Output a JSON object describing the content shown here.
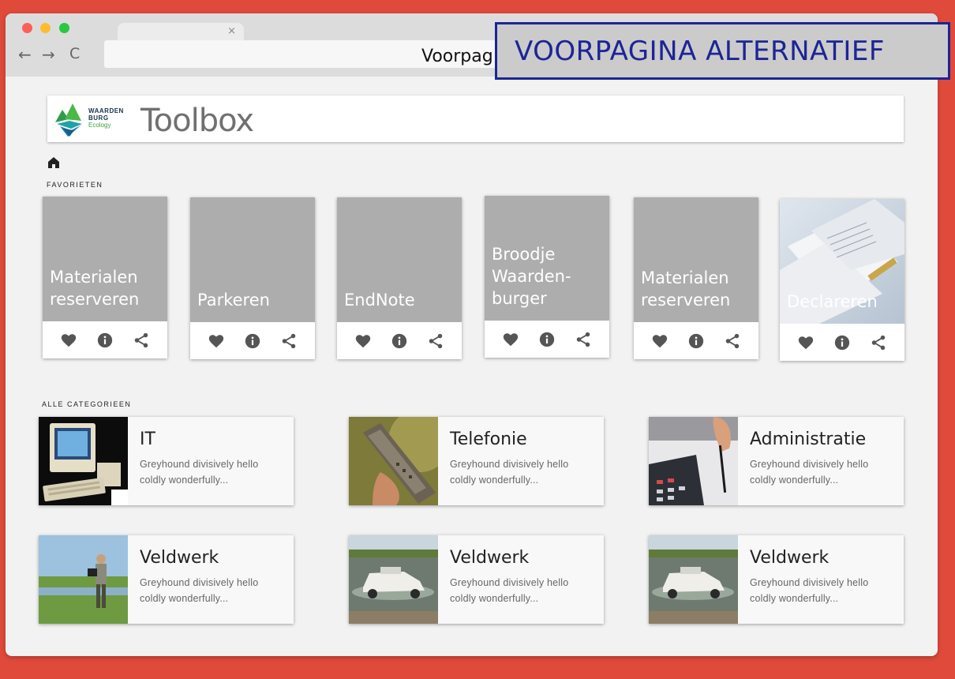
{
  "overlay_label": "VOORPAGINA ALTERNATIEF",
  "browser": {
    "tab_close": "×",
    "back_icon": "←",
    "forward_icon": "→",
    "reload_icon": "C",
    "address_text": "Voorpag"
  },
  "header": {
    "logo_line1": "WAARDEN",
    "logo_line2": "BURG",
    "logo_line3": "Ecology",
    "app_title": "Toolbox"
  },
  "favorites": {
    "section_label": "FAVORIETEN",
    "items": [
      {
        "title": "Materialen\nreserveren",
        "has_image": false
      },
      {
        "title": "Parkeren",
        "has_image": false
      },
      {
        "title": "EndNote",
        "has_image": false
      },
      {
        "title": "Broodje\nWaarden-\nburger",
        "has_image": false
      },
      {
        "title": "Materialen\nreserveren",
        "has_image": false
      },
      {
        "title": "Declareren",
        "has_image": true
      }
    ],
    "action_icons": [
      "heart-icon",
      "info-icon",
      "share-icon"
    ]
  },
  "categories": {
    "section_label": "ALLE CATEGORIEEN",
    "items": [
      {
        "title": "IT",
        "description": "Greyhound divisively hello coldly wonderfully...",
        "image": "vintage-computer"
      },
      {
        "title": "Telefonie",
        "description": "Greyhound divisively hello coldly wonderfully...",
        "image": "brick-phone"
      },
      {
        "title": "Administratie",
        "description": "Greyhound divisively hello coldly wonderfully...",
        "image": "calculator-pen"
      },
      {
        "title": "Veldwerk",
        "description": "Greyhound divisively hello coldly wonderfully...",
        "image": "field-worker"
      },
      {
        "title": "Veldwerk",
        "description": "Greyhound divisively hello coldly wonderfully...",
        "image": "amphibious-car"
      },
      {
        "title": "Veldwerk",
        "description": "Greyhound divisively hello coldly wonderfully...",
        "image": "amphibious-car"
      }
    ]
  },
  "colors": {
    "background": "#e04a3a",
    "overlay_border": "#1c2596",
    "card_grey": "#adadad",
    "icon_grey": "#555555"
  }
}
